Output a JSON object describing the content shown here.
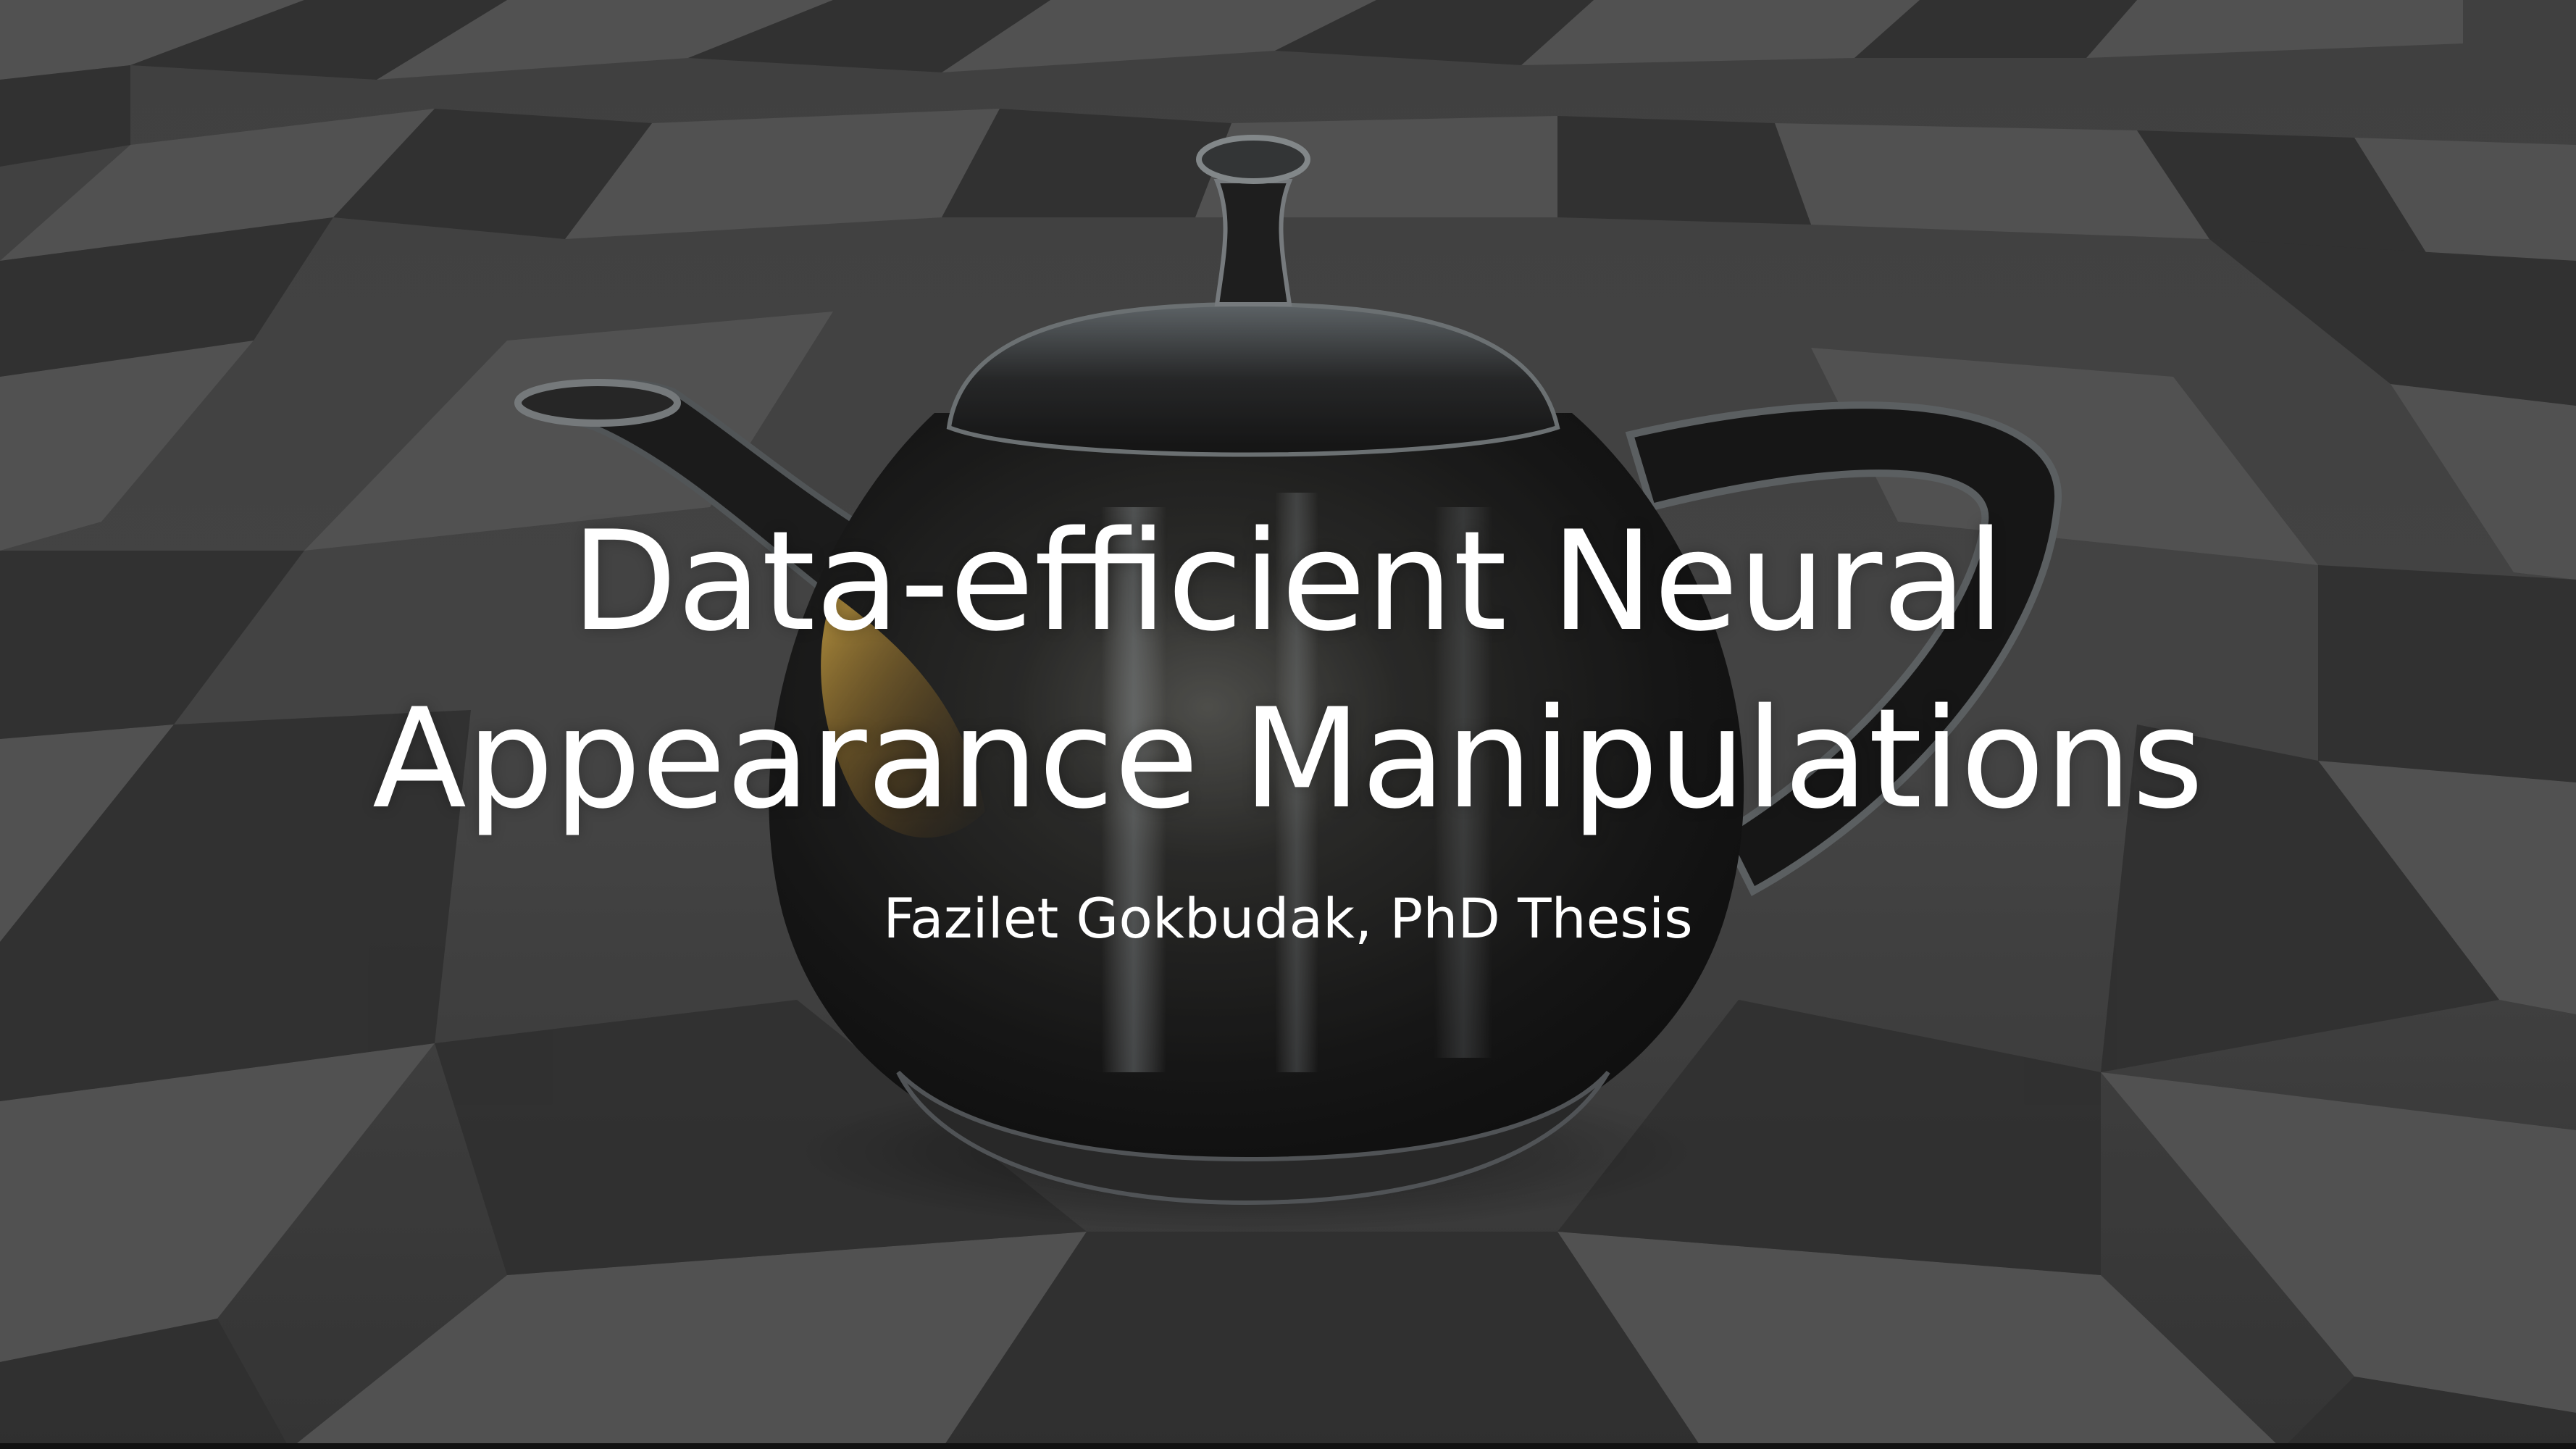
{
  "slide": {
    "title_line_1": "Data-efficient Neural",
    "title_line_2": "Appearance Manipulations",
    "subtitle": "Fazilet Gokbudak, PhD Thesis"
  },
  "background": {
    "description_icon": "teapot-icon",
    "floor_dark": "#3a3a3a",
    "floor_light": "#5c5c5c",
    "teapot_body": "#1c1c1c",
    "teapot_highlight": "#bfc9cf",
    "warm_reflection": "#d9a33a"
  }
}
